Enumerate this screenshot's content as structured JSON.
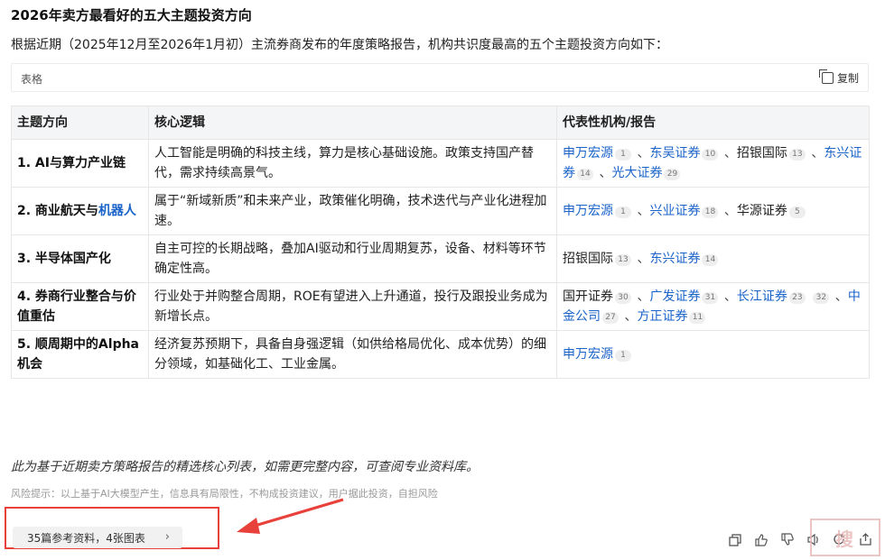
{
  "title": "2026年卖方最看好的五大主题投资方向",
  "intro": "根据近期（2025年12月至2026年1月初）主流券商发布的年度策略报告，机构共识度最高的五个主题投资方向如下：",
  "table_bar": {
    "label": "表格",
    "copy_label": "复制"
  },
  "table": {
    "headers": [
      "主题方向",
      "核心逻辑",
      "代表性机构/报告"
    ],
    "rows": [
      {
        "theme": "1. AI与算力产业链",
        "logic": "人工智能是明确的科技主线，算力是核心基础设施。政策支持国产替代，需求持续高景气。",
        "orgs": [
          {
            "name": "申万宏源",
            "cite": "1",
            "link": true
          },
          {
            "name": "东吴证券",
            "cite": "10",
            "link": true
          },
          {
            "name": "招银国际",
            "cite": "13",
            "link": false
          },
          {
            "name": "东兴证券",
            "cite": "14",
            "link": true
          },
          {
            "name": "光大证券",
            "cite": "29",
            "link": true
          }
        ]
      },
      {
        "theme": "2. 商业航天与",
        "theme_link": "机器人",
        "logic": "属于“新域新质”和未来产业，政策催化明确，技术迭代与产业化进程加速。",
        "orgs": [
          {
            "name": "申万宏源",
            "cite": "1",
            "link": true
          },
          {
            "name": "兴业证券",
            "cite": "18",
            "link": true
          },
          {
            "name": "华源证券",
            "cite": "5",
            "link": false
          }
        ]
      },
      {
        "theme": "3. 半导体国产化",
        "logic": "自主可控的长期战略，叠加AI驱动和行业周期复苏，设备、材料等环节确定性高。",
        "orgs": [
          {
            "name": "招银国际",
            "cite": "13",
            "link": false
          },
          {
            "name": "东兴证券",
            "cite": "14",
            "link": true
          }
        ]
      },
      {
        "theme": "4. 券商行业整合与价值重估",
        "logic": "行业处于并购整合周期，ROE有望进入上升通道，投行及跟投业务成为新增长点。",
        "orgs": [
          {
            "name": "国开证券",
            "cite": "30",
            "link": false
          },
          {
            "name": "广发证券",
            "cite": "31",
            "link": true
          },
          {
            "name": "长江证券",
            "cite": "23",
            "link": true
          },
          {
            "name": "",
            "cite": "32",
            "link": false
          },
          {
            "name": "中金公司",
            "cite": "27",
            "link": true
          },
          {
            "name": "方正证券",
            "cite": "11",
            "link": true
          }
        ]
      },
      {
        "theme": "5. 顺周期中的Alpha机会",
        "logic": "经济复苏预期下，具备自身强逻辑（如供给格局优化、成本优势）的细分领域，如基础化工、工业金属。",
        "orgs": [
          {
            "name": "申万宏源",
            "cite": "1",
            "link": true
          }
        ]
      }
    ]
  },
  "footnote": "此为基于近期卖方策略报告的精选核心列表，如需更完整内容，可查阅专业资料库。",
  "risk_notice": "风险提示：以上基于AI大模型产生，信息具有局限性，不构成投资建议，用户据此投资，自担风险",
  "refs_button": "35篇参考资料，4张图表",
  "stamp_text": "搜",
  "colors": {
    "link": "#1a63c9",
    "highlight": "#e8403a",
    "header_bg": "#f4f5f7"
  },
  "actions": [
    "copy-icon",
    "thumbs-up-icon",
    "thumbs-down-icon",
    "speaker-icon",
    "refresh-icon",
    "share-icon"
  ]
}
